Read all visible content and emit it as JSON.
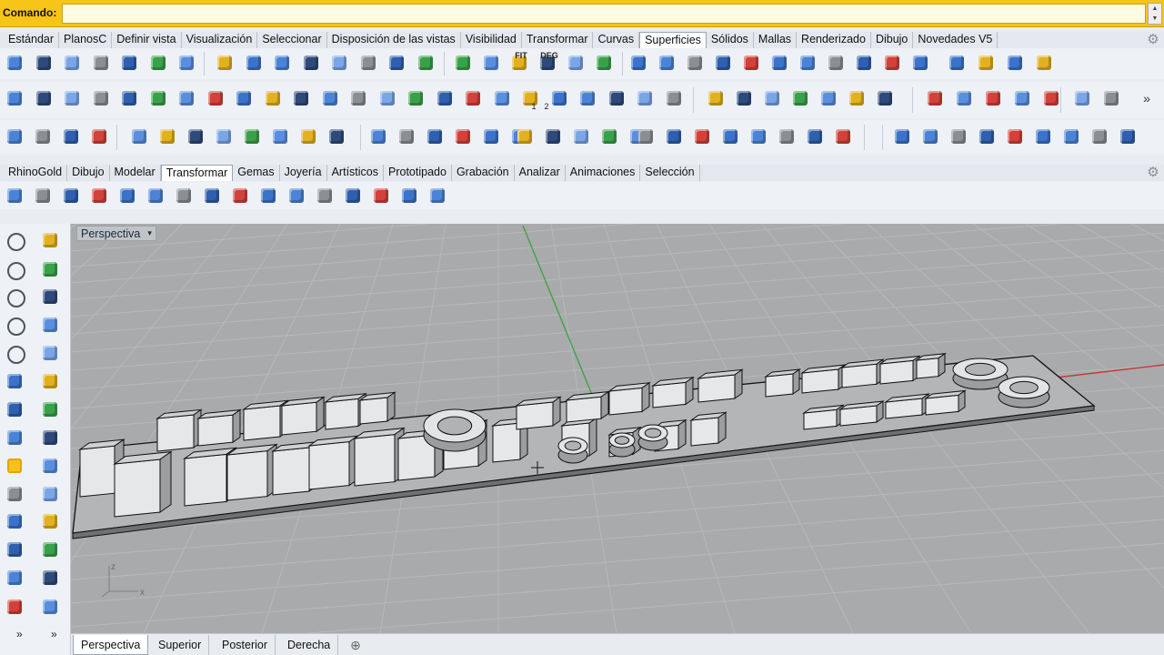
{
  "command_bar": {
    "label": "Comando:",
    "value": "",
    "spin": "▲▼"
  },
  "tabs_top": [
    "Estándar",
    "PlanosC",
    "Definir vista",
    "Visualización",
    "Seleccionar",
    "Disposición de las vistas",
    "Visibilidad",
    "Transformar",
    "Curvas",
    "Superficies",
    "Sólidos",
    "Mallas",
    "Renderizado",
    "Dibujo",
    "Novedades V5"
  ],
  "tabs_top_active": "Superficies",
  "tabs_second": [
    "RhinoGold",
    "Dibujo",
    "Modelar",
    "Transformar",
    "Gemas",
    "Joyería",
    "Artísticos",
    "Prototipado",
    "Grabación",
    "Analizar",
    "Animaciones",
    "Selección"
  ],
  "tabs_second_active": "Transformar",
  "toolbar_text_icons": {
    "fit": "FIT",
    "deg": "DEG",
    "num1": "1",
    "num2": "2"
  },
  "viewport": {
    "title": "Perspectiva",
    "dropdown": "▾",
    "gizmo": {
      "z": "z",
      "x": "x"
    }
  },
  "view_tabs": [
    "Perspectiva",
    "Superior",
    "Posterior",
    "Derecha"
  ],
  "view_tabs_active": "Perspectiva",
  "add_tab": "⊕",
  "sidebar_more": "»",
  "colors": {
    "command_bar": "#f7c418",
    "viewport_bg": "#a9aaab",
    "x_axis": "#c23a3a",
    "y_axis": "#3fa34a",
    "grid": "#b7b8b9"
  }
}
